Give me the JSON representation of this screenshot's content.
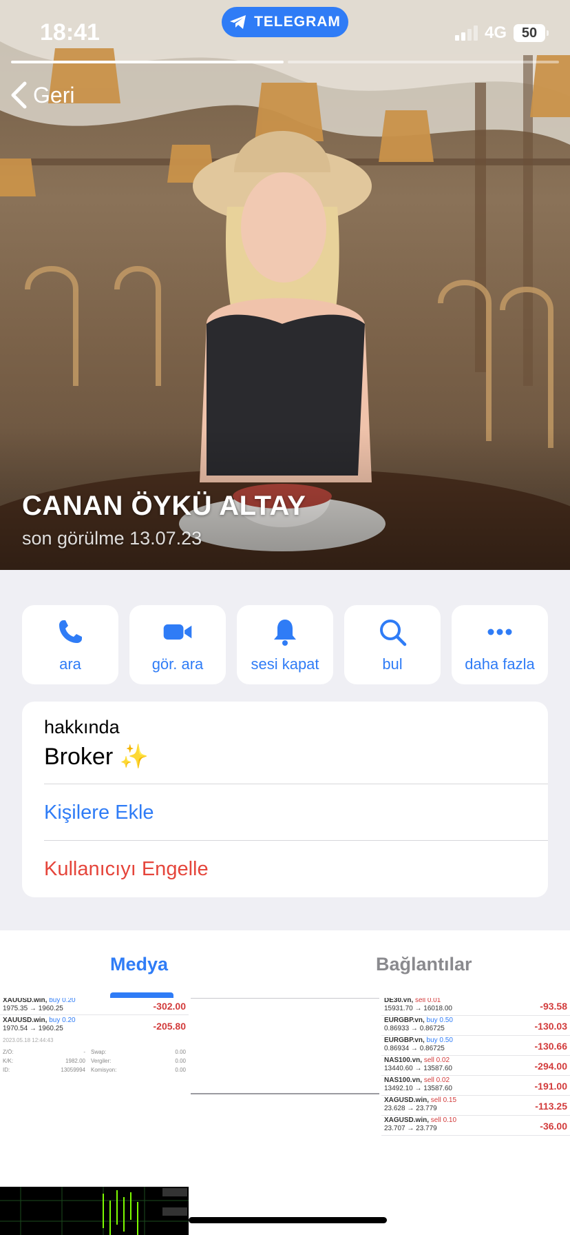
{
  "status_bar": {
    "time": "18:41",
    "app_pill": "TELEGRAM",
    "network": "4G",
    "battery": "50"
  },
  "nav": {
    "back_label": "Geri"
  },
  "profile": {
    "name": "CANAN ÖYKÜ ALTAY",
    "last_seen": "son görülme 13.07.23"
  },
  "actions": [
    {
      "label": "ara",
      "icon": "phone-icon"
    },
    {
      "label": "gör. ara",
      "icon": "video-camera-icon"
    },
    {
      "label": "sesi kapat",
      "icon": "bell-icon"
    },
    {
      "label": "bul",
      "icon": "search-icon"
    },
    {
      "label": "daha fazla",
      "icon": "more-icon"
    }
  ],
  "info": {
    "about_label": "hakkında",
    "about_value": "Broker ✨",
    "add_contact": "Kişilere Ekle",
    "block_user": "Kullanıcıyı Engelle"
  },
  "tabs": {
    "media": "Medya",
    "links": "Bağlantılar"
  },
  "media": {
    "thumb1": {
      "rows": [
        {
          "sym": "XAUUSD.win,",
          "act": "buy 0.20",
          "range": "1975.35 → 1960.25",
          "value": "-302.00"
        },
        {
          "sym": "XAUUSD.win,",
          "act": "buy 0.20",
          "range": "1970.54 → 1960.25",
          "value": "-205.80"
        }
      ],
      "date": "2023.05.18 12:44:43",
      "details": [
        {
          "k1": "Z/Ö:",
          "v1": "-",
          "k2": "Swap:",
          "v2": "0.00"
        },
        {
          "k1": "K/K:",
          "v1": "1982.00",
          "k2": "Vergiler:",
          "v2": "0.00"
        },
        {
          "k1": "ID:",
          "v1": "13059994",
          "k2": "Komisyon:",
          "v2": "0.00"
        }
      ]
    },
    "thumb3": {
      "rows": [
        {
          "sym": "DE30.vn,",
          "act": "sell 0.01",
          "side": "sell",
          "range": "15931.70 → 16018.00",
          "value": "-93.58"
        },
        {
          "sym": "EURGBP.vn,",
          "act": "buy 0.50",
          "side": "buy",
          "range": "0.86933 → 0.86725",
          "value": "-130.03"
        },
        {
          "sym": "EURGBP.vn,",
          "act": "buy 0.50",
          "side": "buy",
          "range": "0.86934 → 0.86725",
          "value": "-130.66"
        },
        {
          "sym": "NAS100.vn,",
          "act": "sell 0.02",
          "side": "sell",
          "range": "13440.60 → 13587.60",
          "value": "-294.00"
        },
        {
          "sym": "NAS100.vn,",
          "act": "sell 0.02",
          "side": "sell",
          "range": "13492.10 → 13587.60",
          "value": "-191.00"
        },
        {
          "sym": "XAGUSD.win,",
          "act": "sell 0.15",
          "side": "sell",
          "range": "23.628 → 23.779",
          "value": "-113.25"
        },
        {
          "sym": "XAGUSD.win,",
          "act": "sell 0.10",
          "side": "sell",
          "range": "23.707 → 23.779",
          "value": "-36.00"
        }
      ]
    }
  },
  "colors": {
    "accent": "#2f7cf6",
    "destructive": "#e5453b",
    "background": "#efeff4"
  }
}
